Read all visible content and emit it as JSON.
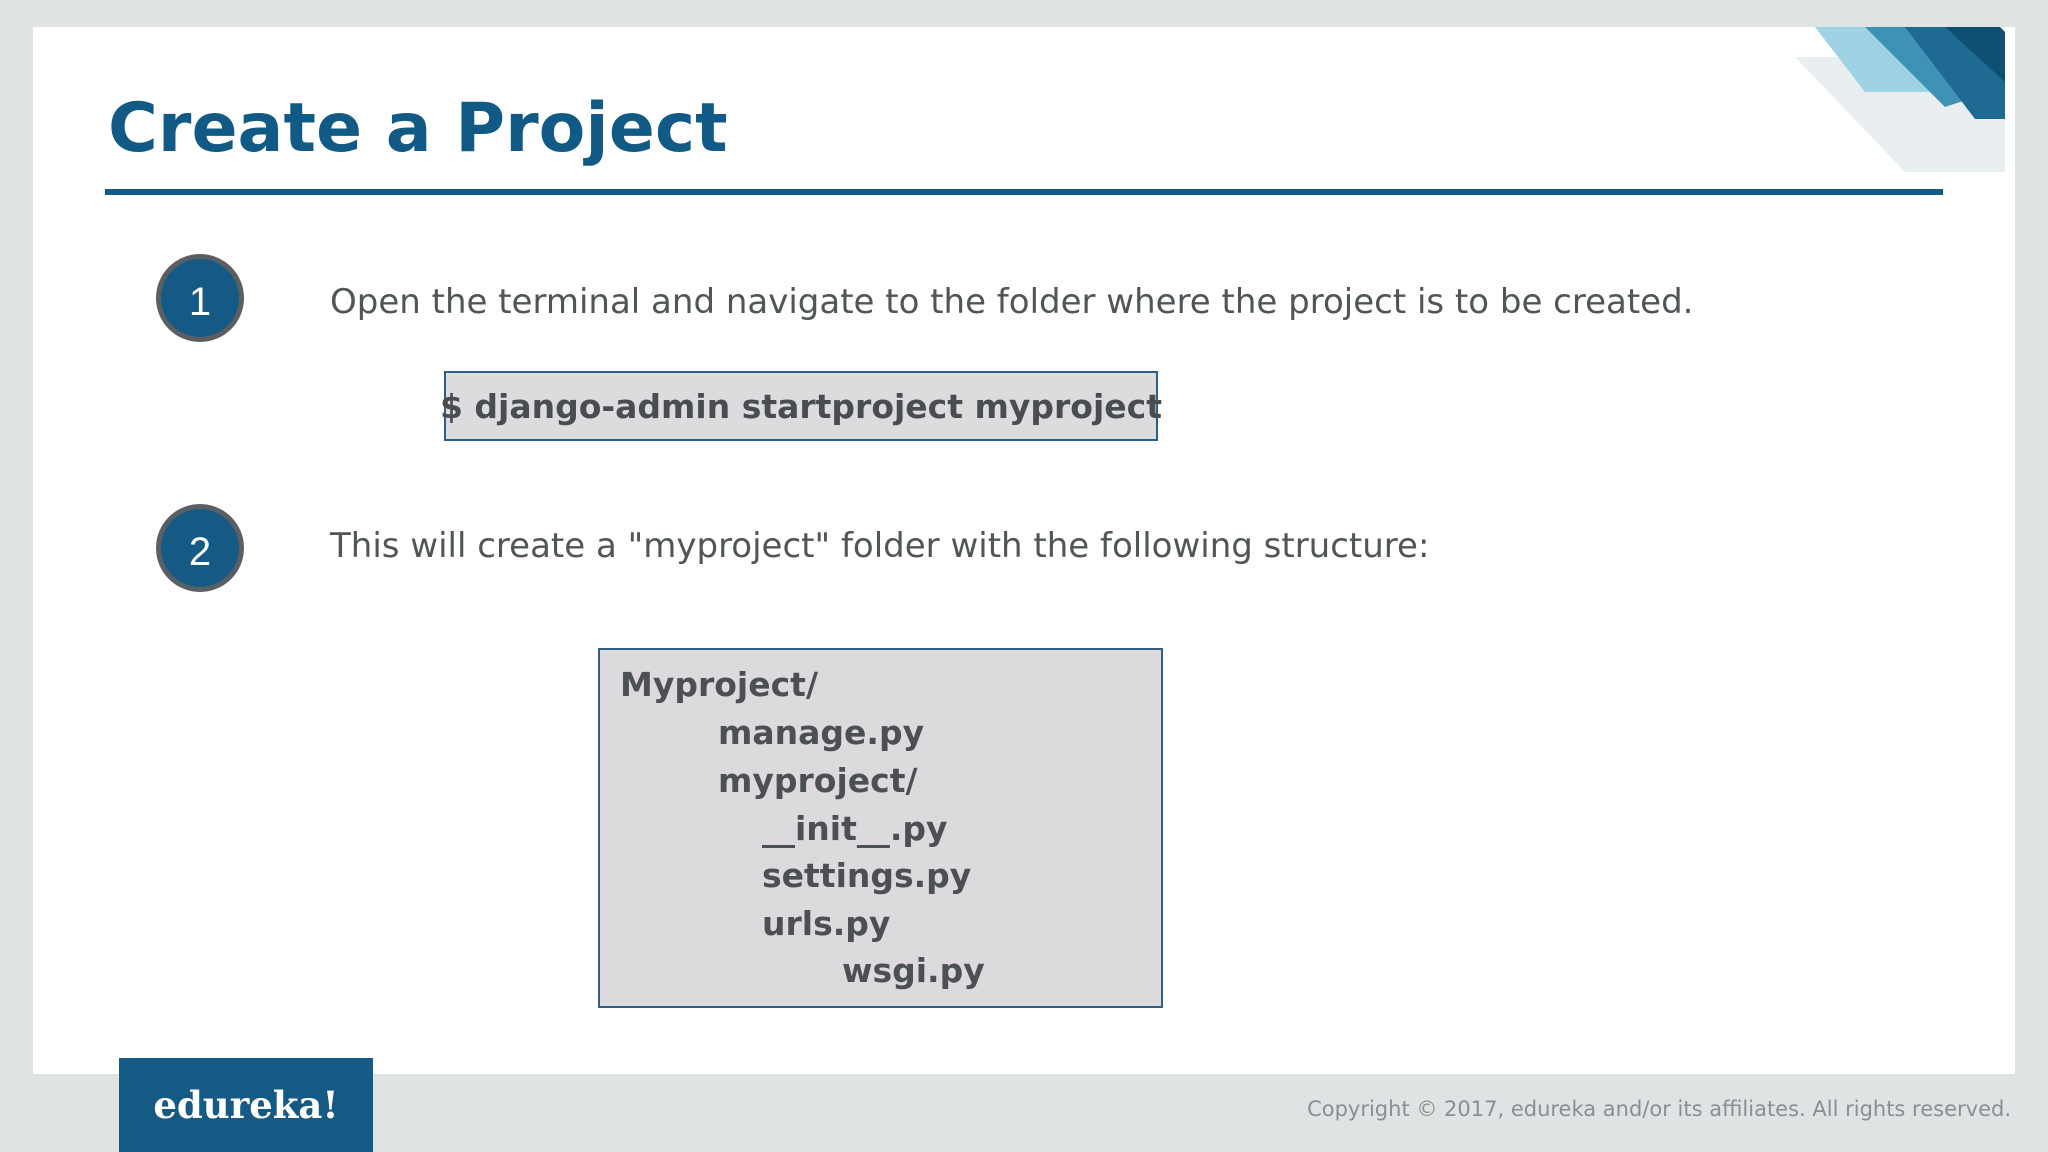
{
  "slide": {
    "title": "Create a Project",
    "steps": [
      {
        "number": "1",
        "text": "Open the terminal and navigate to the folder where the project is to be created."
      },
      {
        "number": "2",
        "text": "This will create a \"myproject\" folder with the following structure:"
      }
    ],
    "command": "$ django-admin startproject myproject",
    "tree": [
      "Myproject/",
      "manage.py",
      "myproject/",
      "__init__.py",
      "settings.py",
      "urls.py",
      "wsgi.py"
    ]
  },
  "footer": {
    "logo": "edureka!",
    "copyright": "Copyright © 2017, edureka and/or its affiliates. All rights reserved."
  },
  "colors": {
    "accent": "#115a86",
    "text": "#505558",
    "box_fill": "#dcdcde",
    "box_border": "#2f5f86"
  }
}
